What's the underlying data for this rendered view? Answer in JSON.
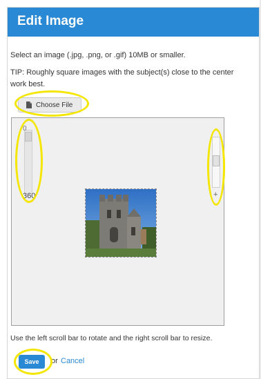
{
  "dialog": {
    "title": "Edit Image",
    "instruction": "Select an image (.jpg, .png, or .gif) 10MB or smaller.",
    "tip_line1": "TIP: Roughly square images with the subject(s) close to the center",
    "tip_line2": "work best.",
    "choose_file_label": "Choose File"
  },
  "editor": {
    "rotate_min": "0",
    "rotate_max": "360",
    "resize_symbol": "+"
  },
  "footer": {
    "help_text": "Use the left scroll bar to rotate and the right scroll bar to resize.",
    "save_label": "Save",
    "or_text": "or",
    "cancel_label": "Cancel"
  },
  "colors": {
    "header_blue": "#2a89d4",
    "highlight_yellow": "#f4e600",
    "canvas_gray": "#f0f0f0"
  },
  "icons": {
    "file": "file-icon"
  }
}
